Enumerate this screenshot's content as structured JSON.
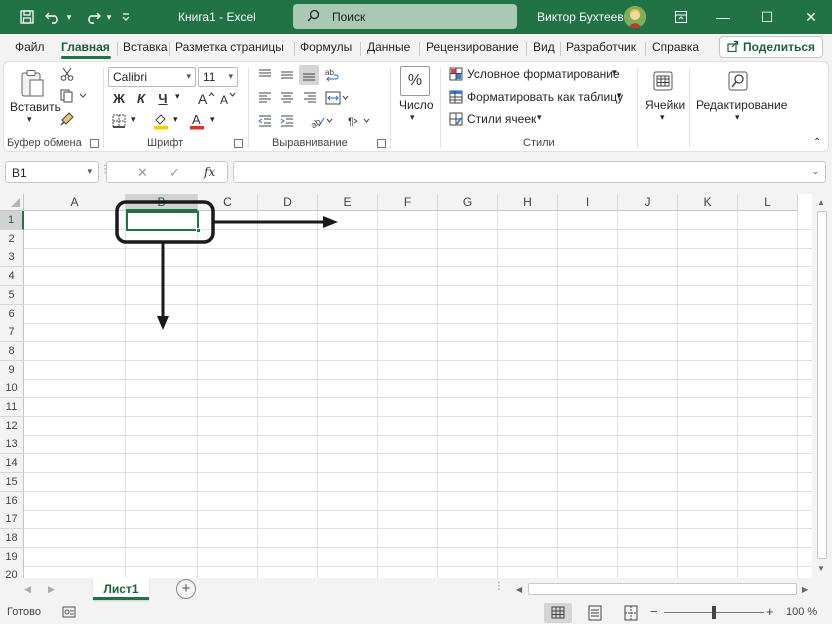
{
  "window": {
    "doc_title": "Книга1  -  Excel",
    "search_label": "Поиск",
    "user_name": "Виктор Бухтеев",
    "minimize": "—",
    "maximize": "☐",
    "close": "✕"
  },
  "quick_access": {
    "save": "🖫",
    "undo": "↶",
    "redo": "↷",
    "customize": "⌄"
  },
  "tabs": [
    "Файл",
    "Главная",
    "Вставка",
    "Разметка страницы",
    "Формулы",
    "Данные",
    "Рецензирование",
    "Вид",
    "Разработчик",
    "Справка"
  ],
  "active_tab": "Главная",
  "share_label": "Поделиться",
  "ribbon": {
    "clipboard": {
      "label": "Буфер обмена",
      "paste": "Вставить"
    },
    "font": {
      "label": "Шрифт",
      "name": "Calibri",
      "size": "11",
      "bold": "Ж",
      "italic": "К",
      "underline": "Ч"
    },
    "alignment": {
      "label": "Выравнивание"
    },
    "number": {
      "label": "Число",
      "button": "Число",
      "icon_text": "%"
    },
    "styles": {
      "label": "Стили",
      "conditional": "Условное форматирование",
      "as_table": "Форматировать как таблицу",
      "cell_styles": "Стили ячеек"
    },
    "cells": {
      "button": "Ячейки"
    },
    "editing": {
      "button": "Редактирование"
    }
  },
  "formula_bar": {
    "name_box": "B1",
    "cancel": "✕",
    "enter": "✓",
    "fx": "fx",
    "value": ""
  },
  "grid": {
    "columns": [
      "A",
      "B",
      "C",
      "D",
      "E",
      "F",
      "G",
      "H",
      "I",
      "J",
      "K",
      "L"
    ],
    "rows": [
      "1",
      "2",
      "3",
      "4",
      "5",
      "6",
      "7",
      "8",
      "9",
      "10",
      "11",
      "12",
      "13",
      "14",
      "15",
      "16",
      "17",
      "18",
      "19",
      "20"
    ],
    "selected_cell": "B1"
  },
  "sheet_tabs": [
    "Лист1"
  ],
  "status": {
    "ready": "Готово",
    "zoom": "100 %",
    "zoom_minus": "−",
    "zoom_plus": "+"
  },
  "colors": {
    "accent": "#217346",
    "annotation": "#1a1a1a"
  }
}
